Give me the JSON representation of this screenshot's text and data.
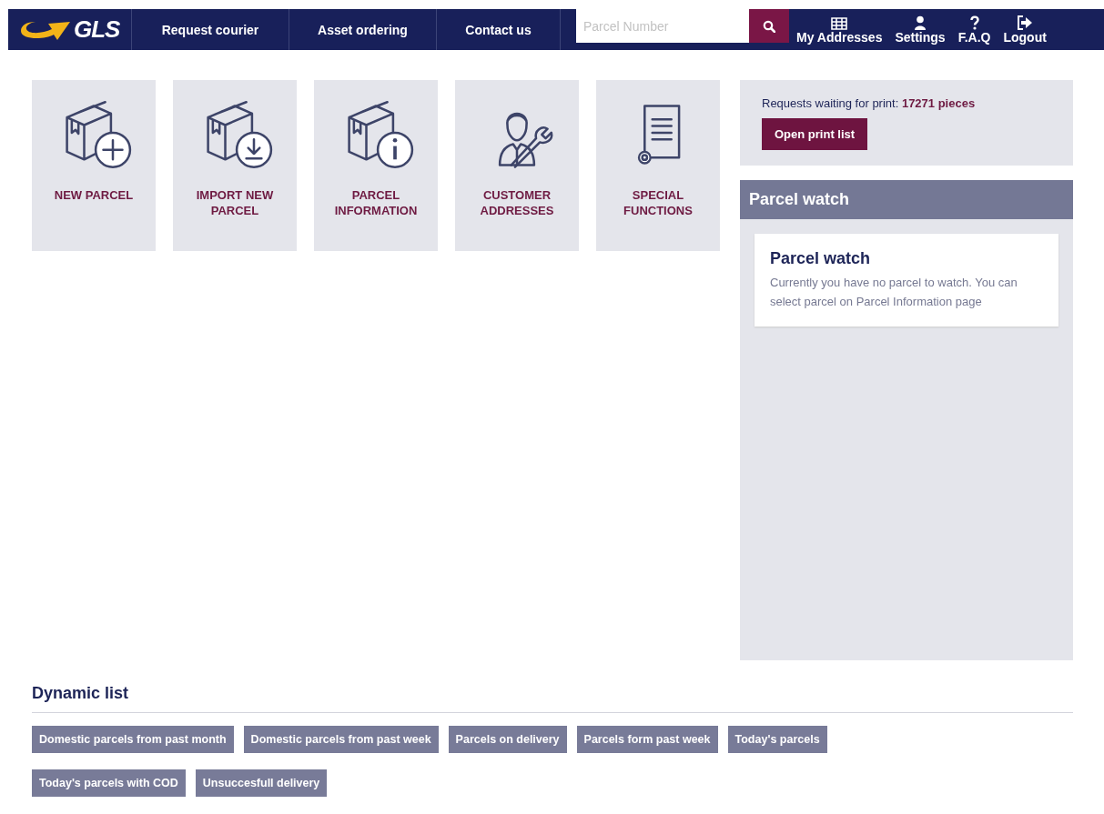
{
  "header": {
    "logo": "GLS",
    "nav_links": [
      {
        "label": "Request courier"
      },
      {
        "label": "Asset ordering"
      },
      {
        "label": "Contact us"
      }
    ],
    "search": {
      "placeholder": "Parcel Number"
    },
    "user_menu": [
      {
        "label": "My Addresses"
      },
      {
        "label": "Settings"
      },
      {
        "label": "F.A.Q"
      },
      {
        "label": "Logout"
      }
    ]
  },
  "tiles": [
    {
      "label": "NEW PARCEL"
    },
    {
      "label": "IMPORT NEW PARCEL"
    },
    {
      "label": "PARCEL INFORMATION"
    },
    {
      "label": "CUSTOMER ADDRESSES"
    },
    {
      "label": "SPECIAL FUNCTIONS"
    }
  ],
  "print_box": {
    "text": "Requests waiting for print: **17271 pieces**",
    "button": "Open print list"
  },
  "parcel_watch": {
    "title": "Parcel watch",
    "card_title": "Parcel watch",
    "card_text": "Currently you have no parcel to watch. You can select parcel on Parcel Information page"
  },
  "dynamic_list": {
    "title": "Dynamic list",
    "items": [
      {
        "label": "Domestic parcels from past month"
      },
      {
        "label": "Domestic parcels from past week"
      },
      {
        "label": "Parcels on delivery"
      },
      {
        "label": "Parcels form past week"
      },
      {
        "label": "Today's parcels"
      },
      {
        "label": "Today's parcels with COD"
      },
      {
        "label": "Unsuccesfull delivery"
      }
    ]
  }
}
